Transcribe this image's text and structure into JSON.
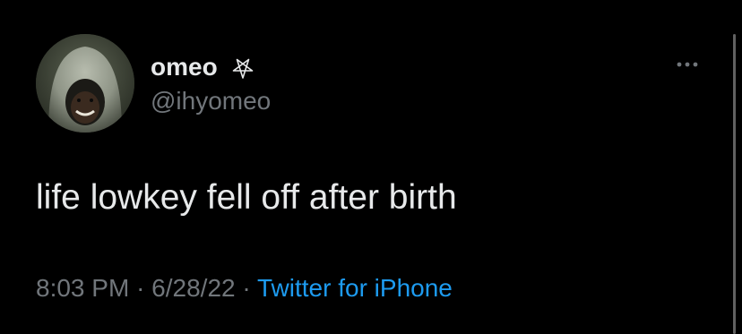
{
  "tweet": {
    "display_name": "omeo",
    "name_icon": "inverted-pentagram-icon",
    "handle": "@ihyomeo",
    "text": "life lowkey fell off after birth",
    "time": "8:03 PM",
    "date": "6/28/22",
    "separator": "·",
    "source": "Twitter for iPhone",
    "more_icon": "more-options-icon"
  },
  "colors": {
    "background": "#000000",
    "primary_text": "#e7e9ea",
    "secondary_text": "#71767b",
    "link": "#1d9bf0"
  }
}
